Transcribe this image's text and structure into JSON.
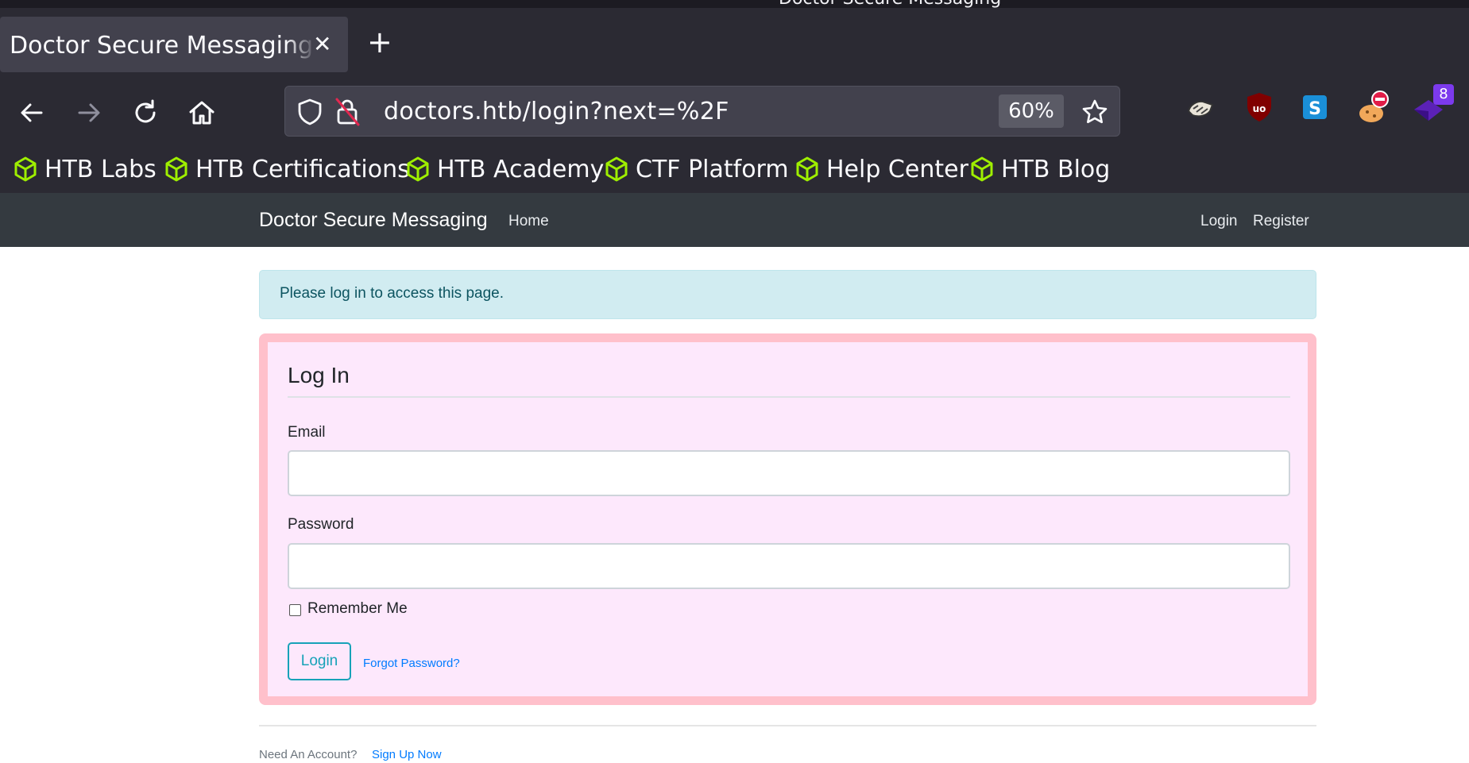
{
  "browser": {
    "window_title": "Doctor Secure Messaging",
    "tab": {
      "title": "Doctor Secure Messaging - Login",
      "close_icon": "close-icon"
    },
    "new_tab_icon": "plus-icon",
    "nav": {
      "back_icon": "arrow-left-icon",
      "forward_icon": "arrow-right-icon",
      "reload_icon": "reload-icon",
      "home_icon": "home-icon"
    },
    "url": "doctors.htb/login?next=%2F",
    "zoom": "60%",
    "extensions": [
      {
        "icon": "wappalyzer-icon"
      },
      {
        "icon": "ublock-origin-icon"
      },
      {
        "icon": "s-extension-icon"
      },
      {
        "icon": "cookie-blocker-icon"
      },
      {
        "icon": "purple-extension-icon",
        "badge": "8"
      }
    ],
    "bookmarks": [
      "HTB Labs",
      "HTB Certifications",
      "HTB Academy",
      "CTF Platform",
      "Help Center",
      "HTB Blog"
    ]
  },
  "site": {
    "brand": "Doctor Secure Messaging",
    "nav_left": [
      "Home"
    ],
    "nav_right": [
      "Login",
      "Register"
    ]
  },
  "alert": {
    "message": "Please log in to access this page."
  },
  "form": {
    "legend": "Log In",
    "email_label": "Email",
    "email_value": "",
    "password_label": "Password",
    "password_value": "",
    "remember_label": "Remember Me",
    "remember_checked": false,
    "submit_label": "Login",
    "forgot_label": "Forgot Password?"
  },
  "footer": {
    "prompt": "Need An Account?",
    "signup_label": "Sign Up Now"
  },
  "colors": {
    "browser_bg": "#2b2a33",
    "site_nav_bg": "#343a40",
    "alert_bg": "#d1ecf1",
    "card_bg": "#fde8fc",
    "card_border": "#ffc0cb",
    "accent": "#17a2b8",
    "link": "#007bff"
  }
}
